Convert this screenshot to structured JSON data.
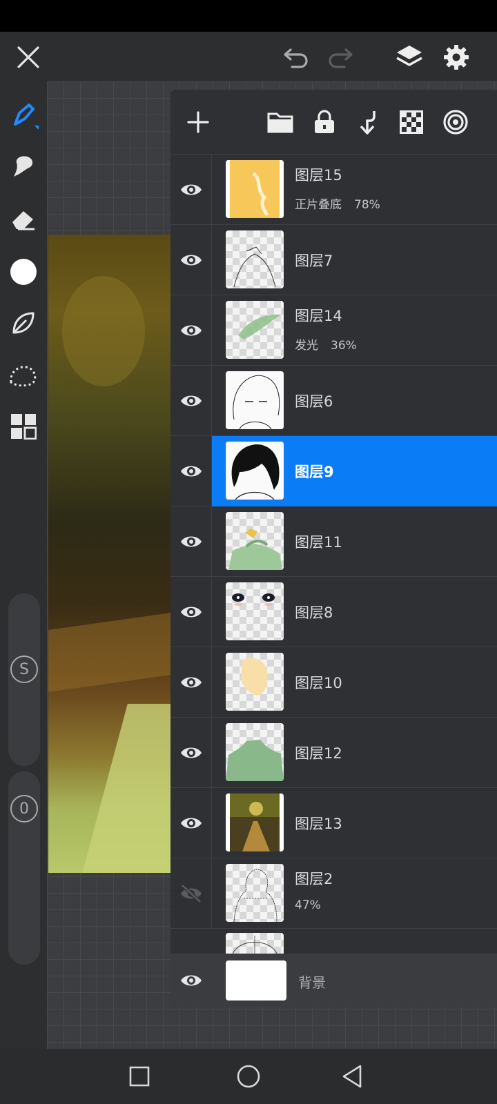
{
  "app": {
    "colors": {
      "accent": "#0a7cf5",
      "panel_bg": "#2e3033",
      "toolbar_bg": "#2c2e30",
      "canvas_grid": "#3b3d40",
      "icon": "#e6e6e6"
    }
  },
  "top_bar": {
    "icons": [
      "close-icon",
      "undo-icon",
      "redo-icon",
      "layers-icon",
      "settings-icon"
    ]
  },
  "left_toolbar": {
    "tools": [
      "brush-icon",
      "smudge-icon",
      "eraser-icon",
      "color-swatch",
      "leaf-icon",
      "lasso-selection-icon",
      "grid-menu-icon"
    ],
    "size_label": "S",
    "opacity_label": "0"
  },
  "layers_panel": {
    "header_icons": [
      "add-layer-icon",
      "folder-icon",
      "lock-icon",
      "merge-down-icon",
      "checkerboard-icon",
      "target-icon"
    ],
    "layers": [
      {
        "name": "图层15",
        "blend": "正片叠底",
        "opacity": "78%",
        "visible": true,
        "selected": false
      },
      {
        "name": "图层7",
        "blend": "",
        "opacity": "",
        "visible": true,
        "selected": false
      },
      {
        "name": "图层14",
        "blend": "发光",
        "opacity": "36%",
        "visible": true,
        "selected": false
      },
      {
        "name": "图层6",
        "blend": "",
        "opacity": "",
        "visible": true,
        "selected": false
      },
      {
        "name": "图层9",
        "blend": "",
        "opacity": "",
        "visible": true,
        "selected": true
      },
      {
        "name": "图层11",
        "blend": "",
        "opacity": "",
        "visible": true,
        "selected": false
      },
      {
        "name": "图层8",
        "blend": "",
        "opacity": "",
        "visible": true,
        "selected": false
      },
      {
        "name": "图层10",
        "blend": "",
        "opacity": "",
        "visible": true,
        "selected": false
      },
      {
        "name": "图层12",
        "blend": "",
        "opacity": "",
        "visible": true,
        "selected": false
      },
      {
        "name": "图层13",
        "blend": "",
        "opacity": "",
        "visible": true,
        "selected": false
      },
      {
        "name": "图层2",
        "blend": "",
        "opacity": "47%",
        "visible": false,
        "selected": false
      }
    ],
    "background_layer": {
      "name": "背景",
      "visible": true
    }
  },
  "nav_bar": {
    "icons": [
      "recents-square-icon",
      "home-circle-icon",
      "back-triangle-icon"
    ]
  }
}
